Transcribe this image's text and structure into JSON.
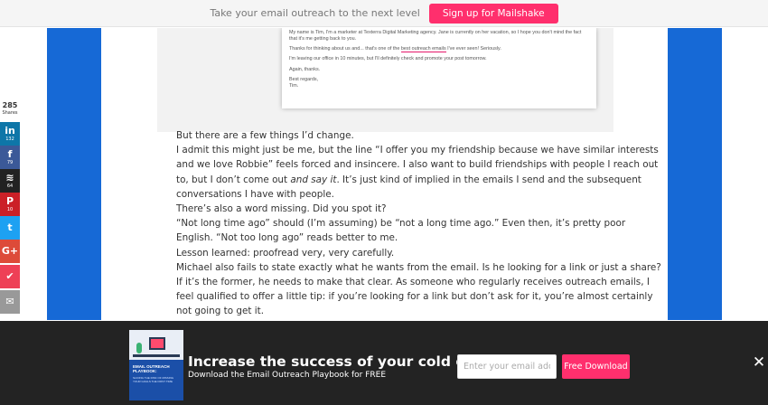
{
  "topbar": {
    "text": "Take your email outreach to the next level",
    "button_label": "Sign up for Mailshake"
  },
  "email_screenshot": {
    "lines": [
      "My name is Tim, I'm a marketer at Texterra Digital Marketing agency. Jane is currently on her vacation, so I hope you don't mind the fact that it's me getting back to you.",
      "Thanks for thinking about us and... that's one of the",
      "best outreach emails",
      "I've ever seen! Seriously.",
      "I'm leaving our office in 10 minutes, but I'll definitely check and promote your post tomorrow.",
      "Again, thanks.",
      "Best regards,",
      "Tim."
    ]
  },
  "article": {
    "lines": [
      "But there are a few things I’d change.",
      "I admit this might just be me, but the line “I offer you my friendship because we have similar interests",
      "and we love Robbie” feels forced and insincere. I also want to build friendships with people I reach out",
      "to, but I don’t come out",
      "and say it",
      ". It’s just kind of implied in the emails I send and the subsequent",
      "conversations I have with people.",
      "There’s also a word missing. Did you spot it?",
      "“Not long time ago” should (I’m assuming) be “not a long time ago.” Even then, it’s pretty poor",
      "English. “Not too long ago” reads better to me.",
      "Lesson learned: proofread very, very carefully.",
      "Michael also fails to state exactly what he wants from the email. Is he looking for a link or just a share?",
      "If it’s the former, he needs to make that clear. As someone who regularly receives outreach emails, I",
      "feel qualified to offer a little tip: if you’re looking for a link but don’t ask for it, you’re almost certainly",
      "not going to get it."
    ]
  },
  "share": {
    "total": "285",
    "total_label": "Shares",
    "buttons": [
      {
        "icon": "in",
        "count": "132",
        "color": "#0e76a8"
      },
      {
        "icon": "f",
        "count": "79",
        "color": "#3b5998"
      },
      {
        "icon": "≋",
        "count": "64",
        "color": "#222222"
      },
      {
        "icon": "P",
        "count": "10",
        "color": "#cb2027"
      },
      {
        "icon": "t",
        "count": "",
        "color": "#1da1f2"
      },
      {
        "icon": "G+",
        "count": "",
        "color": "#dd4b39"
      },
      {
        "icon": "✔",
        "count": "",
        "color": "#ee4056"
      },
      {
        "icon": "✉",
        "count": "",
        "color": "#999999"
      }
    ]
  },
  "promo": {
    "book_title": "EMAIL OUTREACH PLAYBOOK:",
    "book_subtitle": "SLICING THE RISK OF MISSING YOUR GOALS THE FIRST TIME",
    "title": "Increase the success of your cold emails",
    "subtitle": "Download the Email Outreach Playbook for FREE",
    "input_placeholder": "Enter your email address",
    "button_label": "Free Download",
    "close_label": "✕"
  },
  "colors": {
    "accent": "#ff2f6d",
    "column_blue": "#1669d6",
    "banner_bg": "#232323"
  }
}
